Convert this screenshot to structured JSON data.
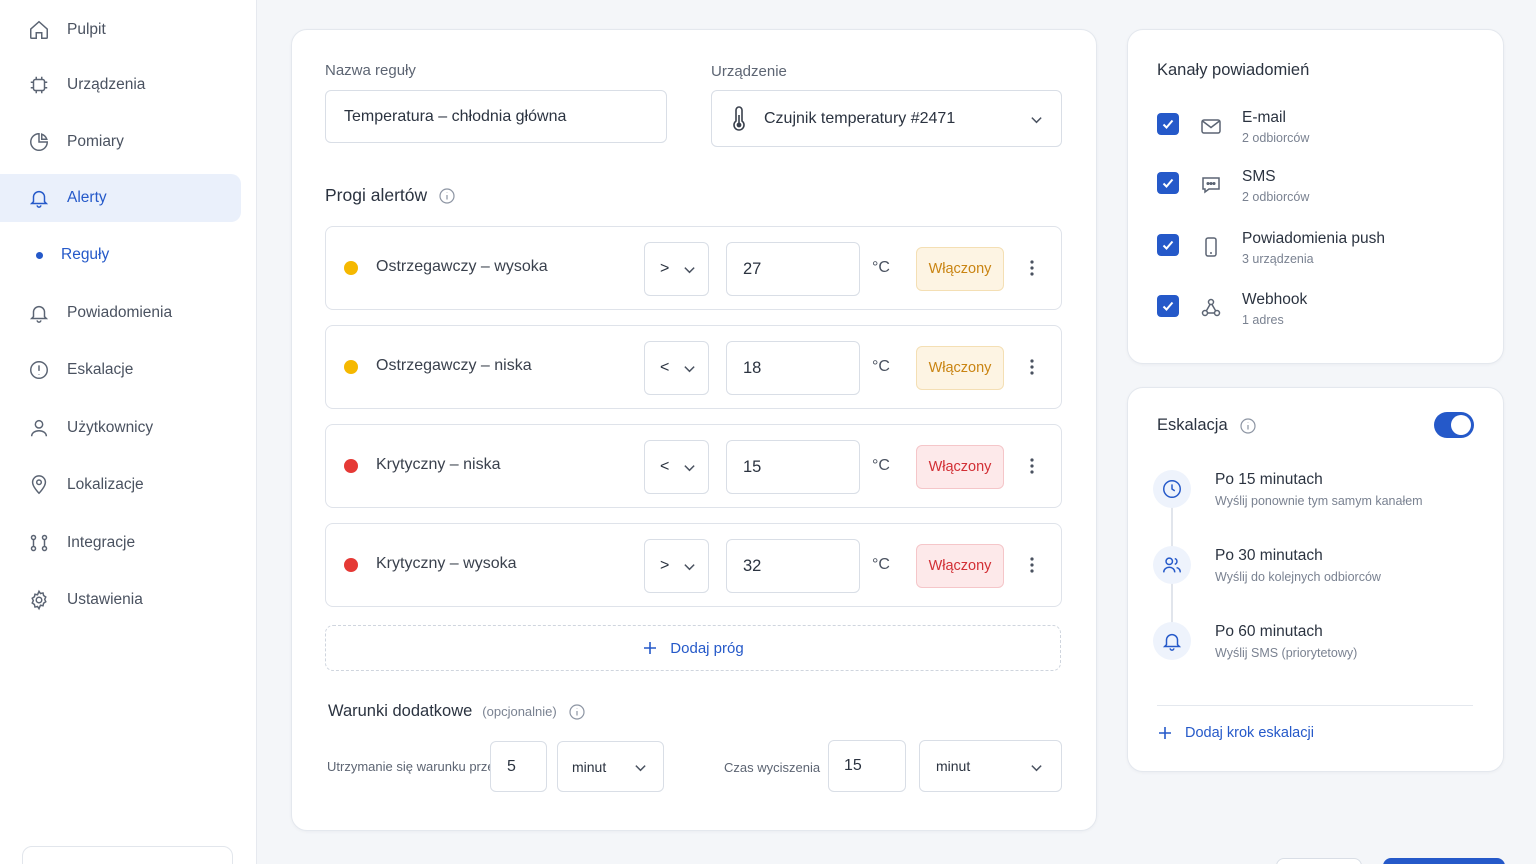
{
  "sidebar": {
    "items": [
      {
        "label": "Pulpit",
        "icon": "home-icon"
      },
      {
        "label": "Urządzenia",
        "icon": "chip-icon"
      },
      {
        "label": "Pomiary",
        "icon": "pie-chart-icon"
      },
      {
        "label": "Alerty",
        "icon": "bell-icon",
        "active": true
      },
      {
        "label": "Reguły",
        "icon": "dot-icon",
        "sub": true
      },
      {
        "label": "Powiadomienia",
        "icon": "bell-icon"
      },
      {
        "label": "Eskalacje",
        "icon": "alert-circle-icon"
      },
      {
        "label": "Użytkownicy",
        "icon": "user-icon"
      },
      {
        "label": "Lokalizacje",
        "icon": "map-pin-icon"
      },
      {
        "label": "Integracje",
        "icon": "nodes-icon"
      },
      {
        "label": "Ustawienia",
        "icon": "gear-icon"
      }
    ]
  },
  "rule": {
    "name_label": "Nazwa reguły",
    "name_value": "Temperatura – chłodnia główna",
    "device_label": "Urządzenie",
    "device_value": "Czujnik temperatury #2471"
  },
  "thresholds": {
    "title": "Progi alertów",
    "unit": "°C",
    "rows": [
      {
        "name": "Ostrzegawczy – wysoka",
        "operator": ">",
        "value": "27",
        "status": "Włączony",
        "severity": "warning",
        "color": "#f5b800"
      },
      {
        "name": "Ostrzegawczy – niska",
        "operator": "<",
        "value": "18",
        "status": "Włączony",
        "severity": "warning",
        "color": "#f5b800"
      },
      {
        "name": "Krytyczny – niska",
        "operator": "<",
        "value": "15",
        "status": "Włączony",
        "severity": "critical",
        "color": "#e53935"
      },
      {
        "name": "Krytyczny – wysoka",
        "operator": ">",
        "value": "32",
        "status": "Włączony",
        "severity": "critical",
        "color": "#e53935"
      }
    ],
    "add_label": "Dodaj próg"
  },
  "conditions": {
    "title": "Warunki dodatkowe",
    "optional": "(opcjonalnie)",
    "hold_label": "Utrzymanie się warunku przez",
    "hold_value": "5",
    "hold_unit": "minut",
    "mute_label": "Czas wyciszenia",
    "mute_value": "15",
    "mute_unit": "minut"
  },
  "channels": {
    "title": "Kanały powiadomień",
    "items": [
      {
        "name": "E-mail",
        "sub": "2 odbiorców",
        "icon": "mail-icon",
        "checked": true
      },
      {
        "name": "SMS",
        "sub": "2 odbiorców",
        "icon": "message-icon",
        "checked": true
      },
      {
        "name": "Powiadomienia push",
        "sub": "3 urządzenia",
        "icon": "phone-icon",
        "checked": true
      },
      {
        "name": "Webhook",
        "sub": "1 adres",
        "icon": "webhook-icon",
        "checked": true
      }
    ]
  },
  "escalation": {
    "title": "Eskalacja",
    "enabled": true,
    "steps": [
      {
        "title": "Po 15 minutach",
        "desc": "Wyślij ponownie tym samym kanałem",
        "icon": "clock-icon"
      },
      {
        "title": "Po 30 minutach",
        "desc": "Wyślij do kolejnych odbiorców",
        "icon": "users-icon"
      },
      {
        "title": "Po 60 minutach",
        "desc": "Wyślij SMS (priorytetowy)",
        "icon": "bell-icon"
      }
    ],
    "add_label": "Dodaj krok eskalacji"
  },
  "colors": {
    "accent": "#2559c9",
    "warning": "#f5b800",
    "critical": "#e53935"
  }
}
